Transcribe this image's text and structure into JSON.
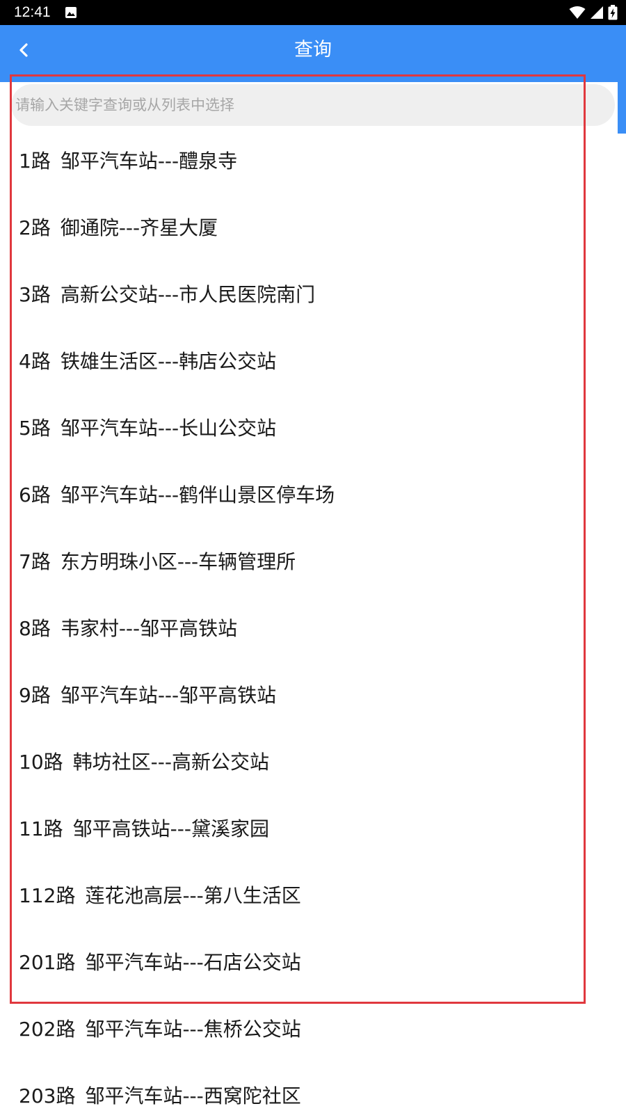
{
  "status_bar": {
    "time": "12:41"
  },
  "app_bar": {
    "title": "查询"
  },
  "search": {
    "placeholder": "请输入关键字查询或从列表中选择"
  },
  "routes": [
    {
      "number": "1路",
      "path": "邹平汽车站---醴泉寺"
    },
    {
      "number": "2路",
      "path": "御通院---齐星大厦"
    },
    {
      "number": "3路",
      "path": "高新公交站---市人民医院南门"
    },
    {
      "number": "4路",
      "path": "铁雄生活区---韩店公交站"
    },
    {
      "number": "5路",
      "path": "邹平汽车站---长山公交站"
    },
    {
      "number": "6路",
      "path": "邹平汽车站---鹤伴山景区停车场"
    },
    {
      "number": "7路",
      "path": "东方明珠小区---车辆管理所"
    },
    {
      "number": "8路",
      "path": "韦家村---邹平高铁站"
    },
    {
      "number": "9路",
      "path": "邹平汽车站---邹平高铁站"
    },
    {
      "number": "10路",
      "path": "韩坊社区---高新公交站"
    },
    {
      "number": "11路",
      "path": "邹平高铁站---黛溪家园"
    },
    {
      "number": "112路",
      "path": "莲花池高层---第八生活区"
    },
    {
      "number": "201路",
      "path": "邹平汽车站---石店公交站"
    },
    {
      "number": "202路",
      "path": "邹平汽车站---焦桥公交站"
    },
    {
      "number": "203路",
      "path": "邹平汽车站---西窝陀社区"
    }
  ],
  "colors": {
    "primary": "#3a8ef6",
    "highlight": "#e0383e"
  }
}
